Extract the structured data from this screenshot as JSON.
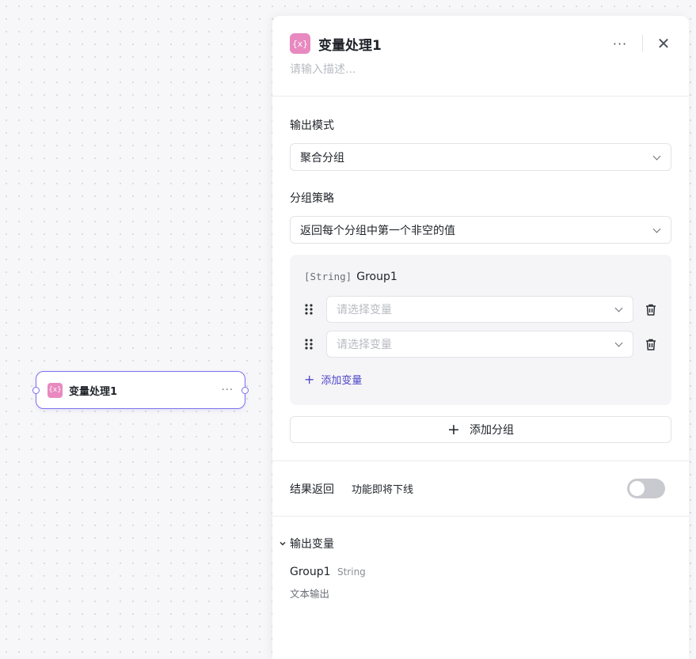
{
  "canvas": {
    "node": {
      "icon": "{x}",
      "title": "变量处理1",
      "more": "···"
    }
  },
  "panel": {
    "icon": "{x}",
    "title": "变量处理1",
    "more": "···",
    "close": "✕",
    "description_placeholder": "请输入描述...",
    "output_mode": {
      "label": "输出模式",
      "value": "聚合分组"
    },
    "group_strategy": {
      "label": "分组策略",
      "value": "返回每个分组中第一个非空的值"
    },
    "group": {
      "type": "[String]",
      "name": "Group1",
      "variables": [
        {
          "placeholder": "请选择变量"
        },
        {
          "placeholder": "请选择变量"
        }
      ],
      "add_variable": "添加变量"
    },
    "add_group": "添加分组",
    "result_return": {
      "label": "结果返回",
      "note": "功能即将下线",
      "enabled": false
    },
    "output_variables": {
      "label": "输出变量",
      "items": [
        {
          "name": "Group1",
          "type": "String",
          "description": "文本输出"
        }
      ]
    }
  },
  "colors": {
    "accent": "#4f46c8",
    "node_border": "#7b6ff0",
    "icon_bg": "#e889c0"
  }
}
